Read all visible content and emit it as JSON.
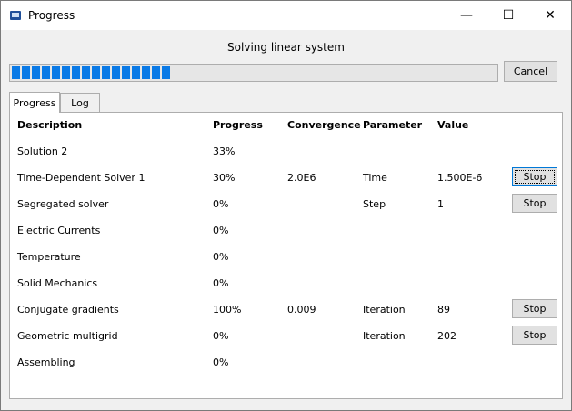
{
  "window": {
    "title": "Progress",
    "controls": {
      "minimize": "—",
      "maximize": "☐",
      "close": "✕"
    }
  },
  "status": "Solving linear system",
  "progress": {
    "fraction": 0.33
  },
  "cancel_label": "Cancel",
  "tabs": [
    {
      "label": "Progress",
      "active": true
    },
    {
      "label": "Log",
      "active": false
    }
  ],
  "table": {
    "headers": {
      "description": "Description",
      "progress": "Progress",
      "convergence": "Convergence",
      "parameter": "Parameter",
      "value": "Value"
    },
    "rows": [
      {
        "description": "Solution 2",
        "progress": "33%",
        "convergence": "",
        "parameter": "",
        "value": "",
        "stop": ""
      },
      {
        "description": "Time-Dependent Solver 1",
        "progress": "30%",
        "convergence": "2.0E6",
        "parameter": "Time",
        "value": "1.500E-6",
        "stop": "Stop"
      },
      {
        "description": "Segregated solver",
        "progress": "0%",
        "convergence": "",
        "parameter": "Step",
        "value": "1",
        "stop": "Stop"
      },
      {
        "description": "Electric Currents",
        "progress": "0%",
        "convergence": "",
        "parameter": "",
        "value": "",
        "stop": ""
      },
      {
        "description": "Temperature",
        "progress": "0%",
        "convergence": "",
        "parameter": "",
        "value": "",
        "stop": ""
      },
      {
        "description": "Solid Mechanics",
        "progress": "0%",
        "convergence": "",
        "parameter": "",
        "value": "",
        "stop": ""
      },
      {
        "description": "Conjugate gradients",
        "progress": "100%",
        "convergence": "0.009",
        "parameter": "Iteration",
        "value": "89",
        "stop": "Stop"
      },
      {
        "description": "Geometric multigrid",
        "progress": "0%",
        "convergence": "",
        "parameter": "Iteration",
        "value": "202",
        "stop": "Stop"
      },
      {
        "description": "Assembling",
        "progress": "0%",
        "convergence": "",
        "parameter": "",
        "value": "",
        "stop": ""
      }
    ]
  }
}
